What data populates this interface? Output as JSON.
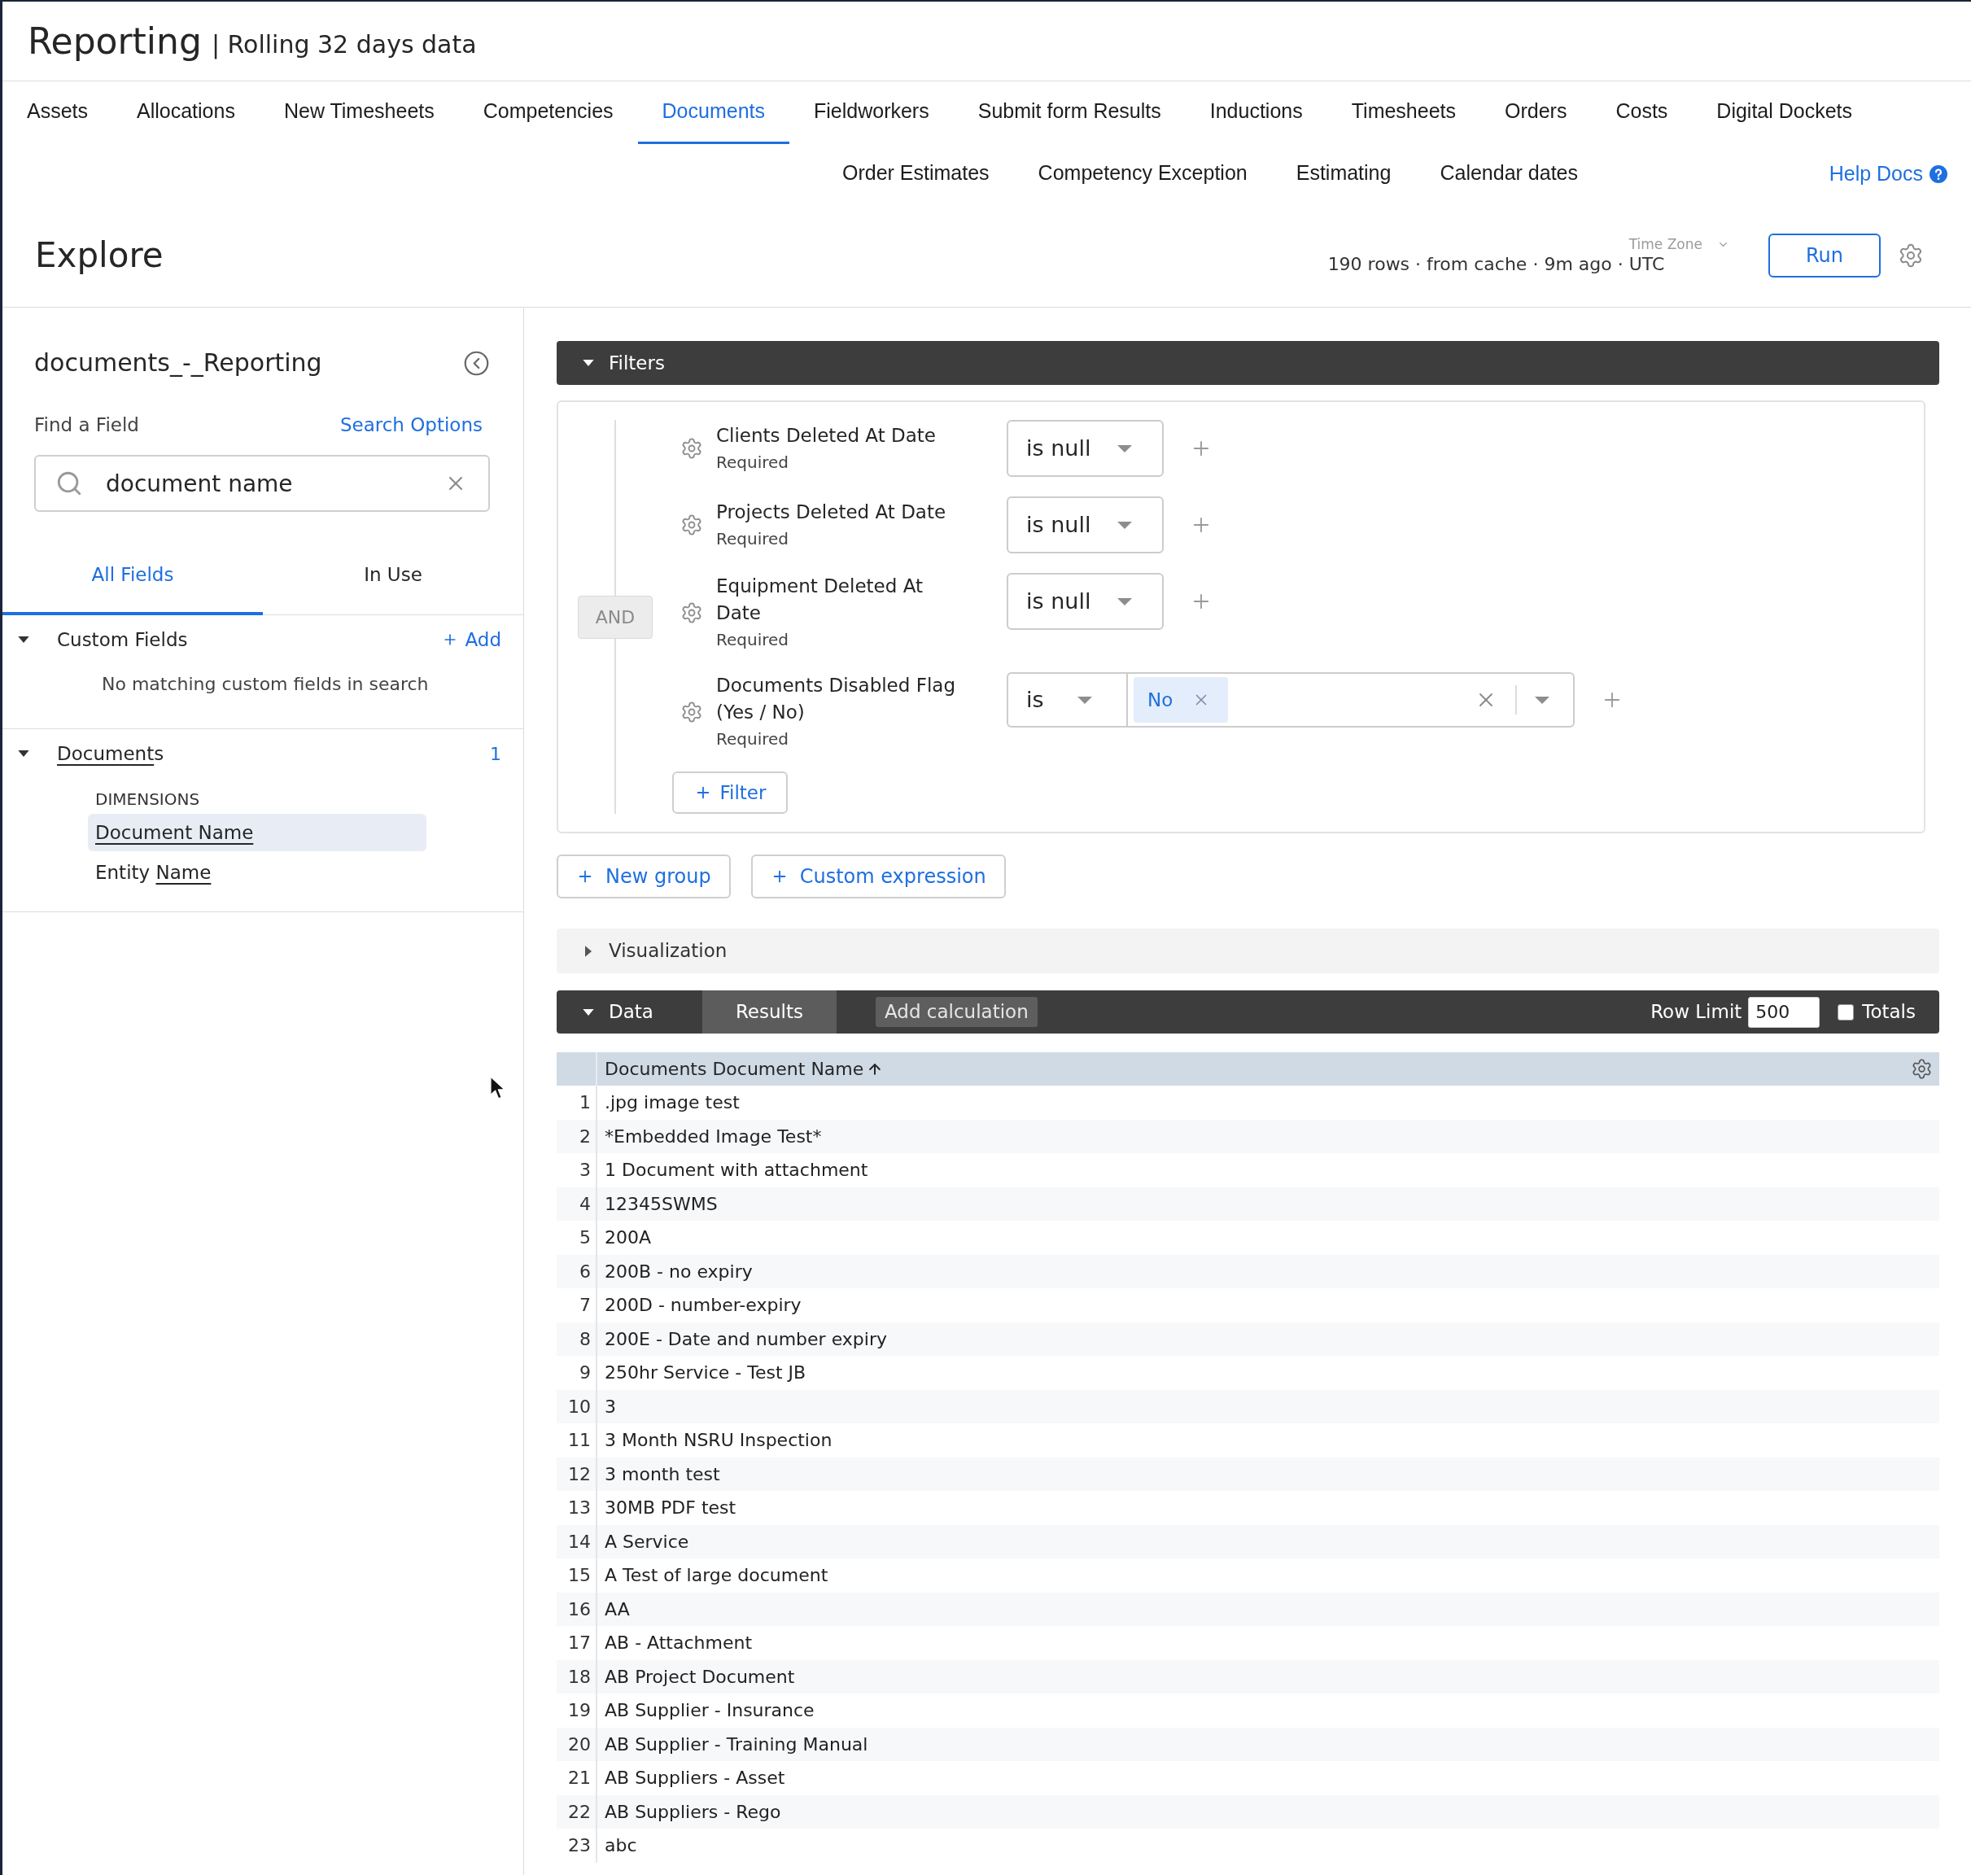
{
  "header": {
    "title": "Reporting",
    "subtitle": "| Rolling 32 days data"
  },
  "nav": {
    "rows": [
      {
        "items": [
          {
            "label": "Assets",
            "selected": false
          },
          {
            "label": "Allocations",
            "selected": false
          },
          {
            "label": "New Timesheets",
            "selected": false
          },
          {
            "label": "Competencies",
            "selected": false
          },
          {
            "label": "Documents",
            "selected": true
          },
          {
            "label": "Fieldworkers",
            "selected": false
          },
          {
            "label": "Submit form Results",
            "selected": false
          },
          {
            "label": "Inductions",
            "selected": false
          },
          {
            "label": "Timesheets",
            "selected": false
          },
          {
            "label": "Orders",
            "selected": false
          },
          {
            "label": "Costs",
            "selected": false
          },
          {
            "label": "Digital Dockets",
            "selected": false
          }
        ]
      },
      {
        "items": [
          {
            "label": "Order Estimates",
            "selected": false
          },
          {
            "label": "Competency Exception",
            "selected": false
          },
          {
            "label": "Estimating",
            "selected": false
          },
          {
            "label": "Calendar dates",
            "selected": false
          }
        ]
      }
    ],
    "help_link": "Help Docs"
  },
  "explore_bar": {
    "title": "Explore",
    "status": "190 rows · from cache · 9m ago ·",
    "time_zone": {
      "label": "Time Zone",
      "value": "UTC"
    },
    "run_button": "Run"
  },
  "field_picker": {
    "title": "documents_-_Reporting",
    "find_label": "Find a Field",
    "search_options_link": "Search Options",
    "search": {
      "value": "document name"
    },
    "tabs": [
      {
        "label": "All Fields",
        "selected": true
      },
      {
        "label": "In Use",
        "selected": false
      }
    ],
    "sections": [
      {
        "kind": "custom",
        "title": [
          {
            "text": "Custom Fields",
            "highlight": false
          }
        ],
        "expanded": true,
        "add_link": "Add",
        "empty_message": "No matching custom fields in search"
      },
      {
        "kind": "view",
        "title": [
          {
            "text": "Document",
            "highlight": true
          },
          {
            "text": "s",
            "highlight": false
          }
        ],
        "expanded": true,
        "count": "1",
        "groups": [
          {
            "heading": "DIMENSIONS",
            "fields": [
              {
                "parts": [
                  {
                    "text": "Document Name",
                    "highlight": true
                  }
                ],
                "selected": true
              },
              {
                "parts": [
                  {
                    "text": "Entity ",
                    "highlight": false
                  },
                  {
                    "text": "Name",
                    "highlight": true
                  }
                ],
                "selected": false
              }
            ]
          }
        ]
      }
    ]
  },
  "filters": {
    "title": "Filters",
    "expanded": true,
    "logic": "AND",
    "rows": [
      {
        "kind": "operator",
        "field": "Clients Deleted At Date",
        "note": "Required",
        "operator": "is null"
      },
      {
        "kind": "operator",
        "field": "Projects Deleted At Date",
        "note": "Required",
        "operator": "is null"
      },
      {
        "kind": "operator",
        "field": "Equipment Deleted At Date",
        "note": "Required",
        "operator": "is null"
      },
      {
        "kind": "values",
        "field": "Documents Disabled Flag (Yes / No)",
        "note": "Required",
        "operator": "is",
        "values": [
          "No"
        ]
      }
    ],
    "add_filter_button": "Filter",
    "actions": [
      "New group",
      "Custom expression"
    ]
  },
  "visualization": {
    "title": "Visualization",
    "expanded": false
  },
  "data": {
    "title": "Data",
    "expanded": true,
    "tabs": [
      {
        "label": "Results",
        "selected": true
      }
    ],
    "add_calculation_button": "Add calculation",
    "row_limit": {
      "label": "Row Limit",
      "value": "500"
    },
    "totals": {
      "label": "Totals",
      "checked": false
    }
  },
  "table": {
    "columns": [
      {
        "label": "Documents Document Name",
        "sorted_ascending": true
      }
    ],
    "rows": [
      {
        "number": "1",
        "cells": [
          ".jpg image test"
        ]
      },
      {
        "number": "2",
        "cells": [
          "*Embedded Image Test*"
        ]
      },
      {
        "number": "3",
        "cells": [
          "1 Document with attachment"
        ]
      },
      {
        "number": "4",
        "cells": [
          "12345SWMS"
        ]
      },
      {
        "number": "5",
        "cells": [
          "200A"
        ]
      },
      {
        "number": "6",
        "cells": [
          "200B - no expiry"
        ]
      },
      {
        "number": "7",
        "cells": [
          "200D - number-expiry"
        ]
      },
      {
        "number": "8",
        "cells": [
          "200E - Date and number expiry"
        ]
      },
      {
        "number": "9",
        "cells": [
          "250hr Service - Test JB"
        ]
      },
      {
        "number": "10",
        "cells": [
          "3"
        ]
      },
      {
        "number": "11",
        "cells": [
          "3 Month NSRU Inspection"
        ]
      },
      {
        "number": "12",
        "cells": [
          "3 month test"
        ]
      },
      {
        "number": "13",
        "cells": [
          "30MB PDF test"
        ]
      },
      {
        "number": "14",
        "cells": [
          "A Service"
        ]
      },
      {
        "number": "15",
        "cells": [
          "A Test of large document"
        ]
      },
      {
        "number": "16",
        "cells": [
          "AA"
        ]
      },
      {
        "number": "17",
        "cells": [
          "AB - Attachment"
        ]
      },
      {
        "number": "18",
        "cells": [
          "AB Project Document"
        ]
      },
      {
        "number": "19",
        "cells": [
          "AB Supplier - Insurance"
        ]
      },
      {
        "number": "20",
        "cells": [
          "AB Supplier - Training Manual"
        ]
      },
      {
        "number": "21",
        "cells": [
          "AB Suppliers - Asset"
        ]
      },
      {
        "number": "22",
        "cells": [
          "AB Suppliers - Rego"
        ]
      },
      {
        "number": "23",
        "cells": [
          "abc"
        ]
      }
    ]
  }
}
